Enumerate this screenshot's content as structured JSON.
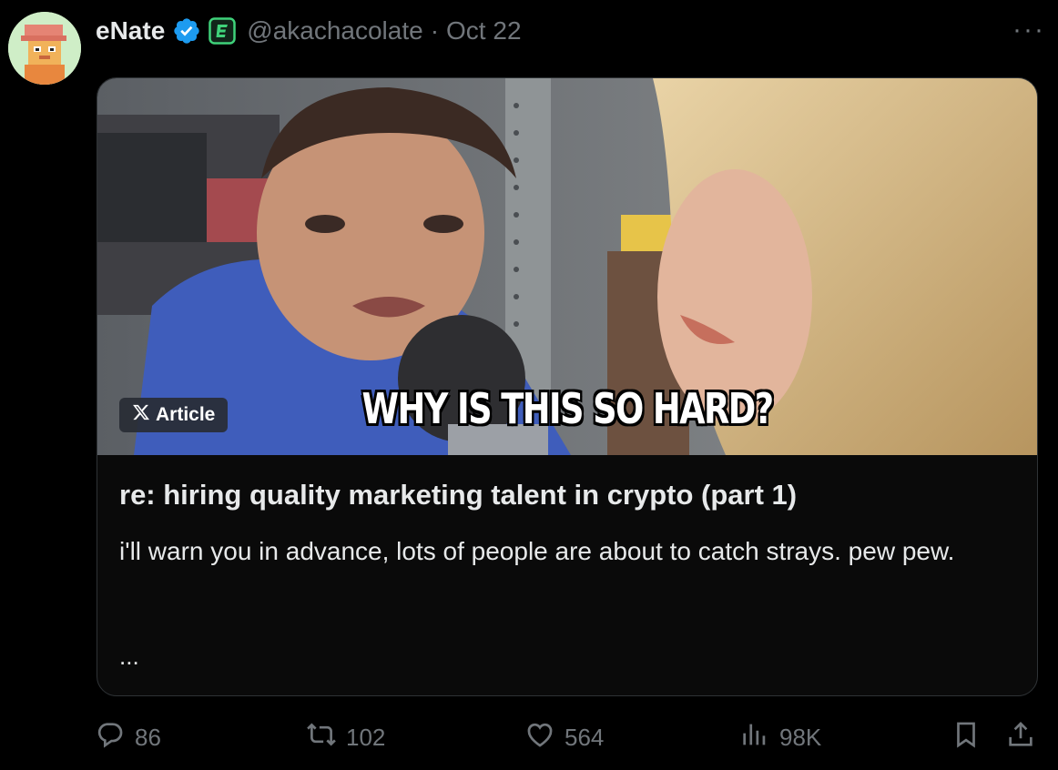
{
  "tweet": {
    "author_name": "eNate",
    "handle": "@akachacolate",
    "separator": "·",
    "date": "Oct 22",
    "more_label": "···"
  },
  "article_card": {
    "tag_label": "Article",
    "image_caption": "WHY IS THIS SO HARD?",
    "title": "re: hiring quality marketing talent in crypto (part 1)",
    "description": "i'll warn you in advance, lots of people are about to catch strays. pew pew.",
    "ellipsis": "..."
  },
  "actions": {
    "replies": "86",
    "reposts": "102",
    "likes": "564",
    "views": "98K"
  },
  "icons": [
    "verified-badge-icon",
    "e-badge-icon",
    "x-logo-icon",
    "reply-icon",
    "repost-icon",
    "like-icon",
    "views-icon",
    "bookmark-icon",
    "share-icon"
  ],
  "colors": {
    "background": "#000000",
    "text": "#e7e9ea",
    "muted": "#71767b",
    "verified": "#1d9bf0",
    "card_border": "#2f3336"
  }
}
